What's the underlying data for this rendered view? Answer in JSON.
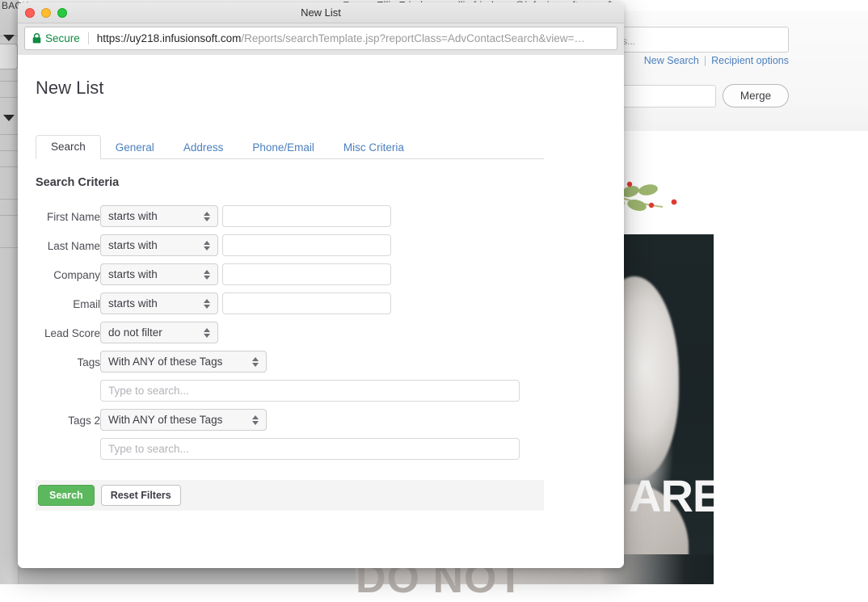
{
  "background": {
    "back_label": "BACK",
    "from_label": "From:",
    "from_value": "Ellis Friedman <ellis.friedman@infusionsoft.com>",
    "edit_icon": "pencil-icon",
    "search_placeholder": "s...",
    "new_search_link": "New Search",
    "link_separator": "|",
    "recipient_options_link": "Recipient options",
    "merge_button": "Merge",
    "hero_word": "ARE",
    "bottom_word": "DO NOT"
  },
  "window": {
    "title": "New List",
    "traffic_lights": [
      "close-button",
      "minimize-button",
      "maximize-button"
    ],
    "security_label": "Secure",
    "security_icon": "lock-icon",
    "url_host": "https://uy218.infusionsoft.com",
    "url_path": "/Reports/searchTemplate.jsp?reportClass=AdvContactSearch&view=…"
  },
  "dialog": {
    "page_title": "New List",
    "tabs": [
      {
        "label": "Search",
        "active": true
      },
      {
        "label": "General",
        "active": false
      },
      {
        "label": "Address",
        "active": false
      },
      {
        "label": "Phone/Email",
        "active": false
      },
      {
        "label": "Misc Criteria",
        "active": false
      }
    ],
    "section_title": "Search Criteria",
    "fields": [
      {
        "label": "First Name",
        "operator": "starts with",
        "value": "",
        "placeholder": ""
      },
      {
        "label": "Last Name",
        "operator": "starts with",
        "value": "",
        "placeholder": ""
      },
      {
        "label": "Company",
        "operator": "starts with",
        "value": "",
        "placeholder": ""
      },
      {
        "label": "Email",
        "operator": "starts with",
        "value": "",
        "placeholder": ""
      }
    ],
    "lead_score": {
      "label": "Lead Score",
      "operator": "do not filter"
    },
    "tags": {
      "label": "Tags",
      "operator": "With ANY of these Tags",
      "search_value": "",
      "search_placeholder": "Type to search..."
    },
    "tags2": {
      "label": "Tags 2",
      "operator": "With ANY of these Tags",
      "search_value": "",
      "search_placeholder": "Type to search..."
    },
    "actions": {
      "search_button": "Search",
      "reset_button": "Reset Filters",
      "search_button_color": "#5cb85c"
    }
  }
}
